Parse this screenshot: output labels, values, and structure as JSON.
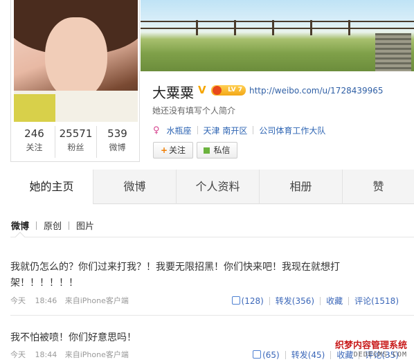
{
  "profile": {
    "name": "大粟粟",
    "verified_badge": "V",
    "level_badge": "LV 7",
    "url": "http://weibo.com/u/1728439965",
    "intro": "她还没有填写个人简介",
    "gender_icon": "female-icon",
    "tags": [
      "水瓶座",
      "天津 南开区",
      "公司体育工作大队"
    ],
    "stats": [
      {
        "num": "246",
        "label": "关注"
      },
      {
        "num": "25571",
        "label": "粉丝"
      },
      {
        "num": "539",
        "label": "微博"
      }
    ],
    "follow_label": "关注",
    "follow_plus": "+",
    "message_label": "私信"
  },
  "tabs": [
    "她的主页",
    "微博",
    "个人资料",
    "相册",
    "赞"
  ],
  "feed_nav": [
    "微博",
    "原创",
    "图片"
  ],
  "posts": [
    {
      "text": "我就仍怎么的？你们过来打我？！我要无限招黑！你们快来吧！我现在就想打架！！！！！！",
      "date": "今天",
      "time": "18:46",
      "source": "来自iPhone客户端",
      "likes": "(128)",
      "repost": "转发(356)",
      "fav": "收藏",
      "comment": "评论(1518)"
    },
    {
      "text": "我不怕被喷！你们好意思吗！",
      "date": "今天",
      "time": "18:44",
      "source": "来自iPhone客户端",
      "likes": "(65)",
      "repost": "转发(45)",
      "fav": "收藏",
      "comment": "评论(35)"
    }
  ],
  "watermark": {
    "line1": "织梦内容管理系统",
    "line2": "DEDECMS.COM"
  },
  "colors": {
    "link": "#2f5fa5",
    "accent": "#f07c00",
    "verified": "#f5a500"
  }
}
